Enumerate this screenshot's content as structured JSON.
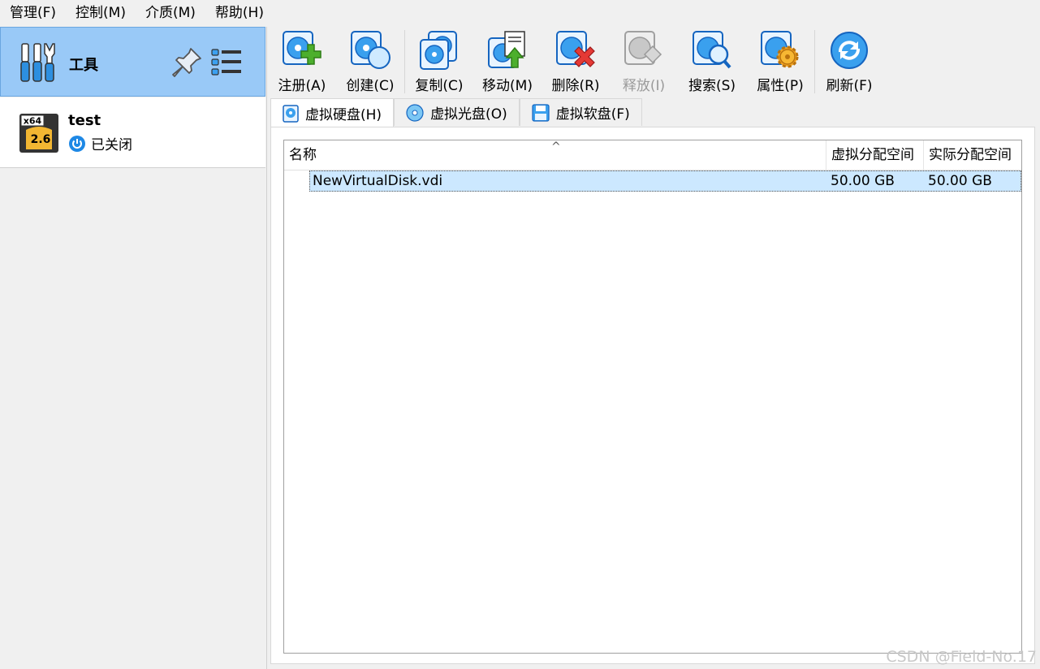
{
  "menu": [
    "管理(F)",
    "控制(M)",
    "介质(M)",
    "帮助(H)"
  ],
  "sidebar": {
    "tools_label": "工具",
    "vm": {
      "os_badge_top": "x64",
      "os_badge_version": "2.6",
      "name": "test",
      "state": "已关闭"
    }
  },
  "toolbar": {
    "register": "注册(A)",
    "create": "创建(C)",
    "copy": "复制(C)",
    "move": "移动(M)",
    "remove": "删除(R)",
    "release": "释放(I)",
    "search": "搜索(S)",
    "properties": "属性(P)",
    "refresh": "刷新(F)"
  },
  "tabs": [
    "虚拟硬盘(H)",
    "虚拟光盘(O)",
    "虚拟软盘(F)"
  ],
  "table": {
    "columns": [
      "名称",
      "虚拟分配空间",
      "实际分配空间"
    ],
    "sort_indicator": "^",
    "rows": [
      {
        "name": "NewVirtualDisk.vdi",
        "virtual_size": "50.00 GB",
        "actual_size": "50.00 GB"
      }
    ]
  },
  "watermark": "CSDN @Field-No.17",
  "colors": {
    "selection": "#99c9f7",
    "row_selected": "#cce8ff",
    "accent": "#1e88e5"
  }
}
